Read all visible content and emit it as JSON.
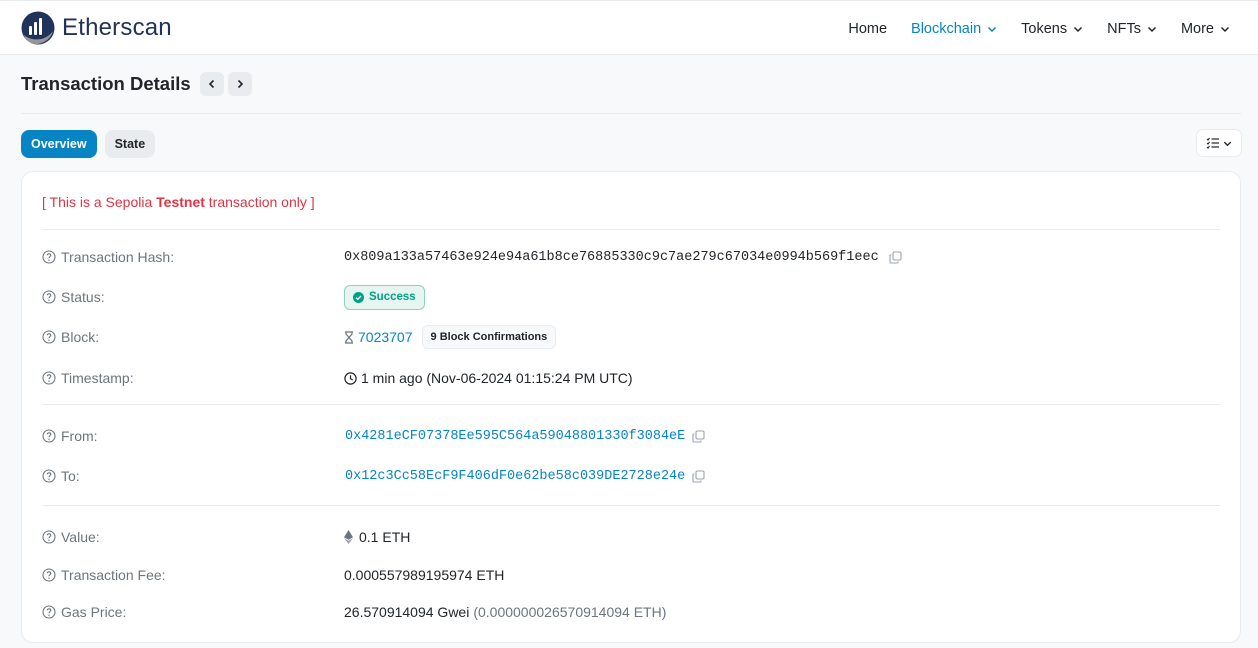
{
  "header": {
    "logo_text": "Etherscan",
    "nav": [
      {
        "label": "Home",
        "active": false,
        "dropdown": false
      },
      {
        "label": "Blockchain",
        "active": true,
        "dropdown": true
      },
      {
        "label": "Tokens",
        "active": false,
        "dropdown": true
      },
      {
        "label": "NFTs",
        "active": false,
        "dropdown": true
      },
      {
        "label": "More",
        "active": false,
        "dropdown": true
      }
    ]
  },
  "page": {
    "title": "Transaction Details"
  },
  "tabs": {
    "overview": "Overview",
    "state": "State"
  },
  "card": {
    "notice_prefix": "[ This is a Sepolia ",
    "notice_bold": "Testnet",
    "notice_suffix": " transaction only ]",
    "rows": {
      "hash": {
        "label": "Transaction Hash:",
        "value": "0x809a133a57463e924e94a61b8ce76885330c9c7ae279c67034e0994b569f1eec"
      },
      "status": {
        "label": "Status:",
        "value": "Success"
      },
      "block": {
        "label": "Block:",
        "value": "7023707",
        "confirmations": "9 Block Confirmations"
      },
      "timestamp": {
        "label": "Timestamp:",
        "value": "1 min ago (Nov-06-2024 01:15:24 PM UTC)"
      },
      "from": {
        "label": "From:",
        "value": "0x4281eCF07378Ee595C564a59048801330f3084eE"
      },
      "to": {
        "label": "To:",
        "value": "0x12c3Cc58EcF9F406dF0e62be58c039DE2728e24e"
      },
      "value": {
        "label": "Value:",
        "value": "0.1 ETH"
      },
      "fee": {
        "label": "Transaction Fee:",
        "value": "0.000557989195974 ETH"
      },
      "gas_price": {
        "label": "Gas Price:",
        "value": "26.570914094 Gwei",
        "value_eth": "(0.000000026570914094 ETH)"
      }
    }
  },
  "colors": {
    "accent": "#0784c3",
    "danger": "#dc3545",
    "success": "#00a186",
    "brand": "#21325b"
  }
}
